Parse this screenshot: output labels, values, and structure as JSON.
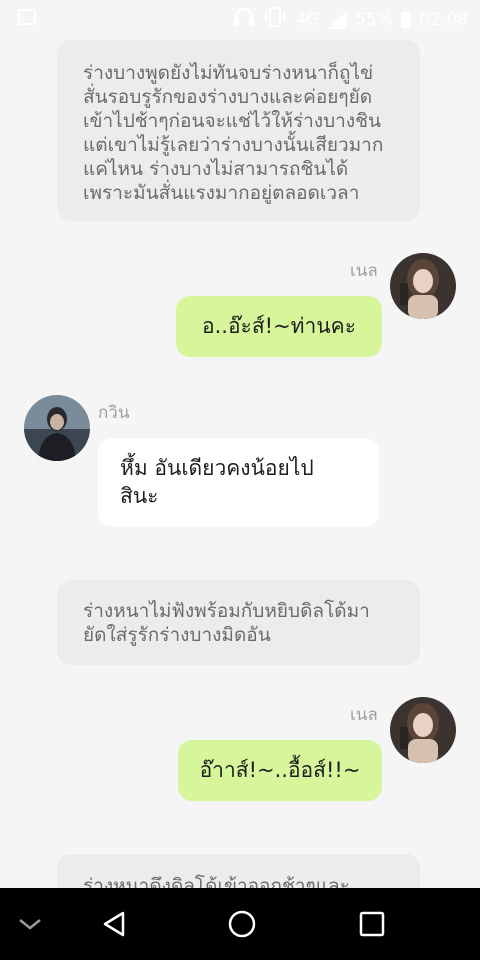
{
  "status_bar": {
    "network": "4G",
    "battery": "55%",
    "time": "02:08"
  },
  "messages": {
    "narration1": "ร่างบางพูดยังไม่ทันจบร่างหนาก็ถูไข่\nสั่นรอบรูรักของร่างบางและค่อยๆยัด\nเข้าไปช้าๆก่อนจะแช่ไว้ให้ร่างบางชิน\nแต่เขาไม่รู้เลยว่าร่างบางนั้นเสียวมาก\nแค่ไหน ร่างบางไม่สามารถชินได้\nเพราะมันสั่นแรงมากอยู่ตลอดเวลา",
    "nel_name_1": "เนล",
    "nel_msg_1": "อ..อ๊ะส์!~ท่านคะ",
    "gwin_name": "กวิน",
    "gwin_msg": "หึ้ม อันเดียวคงน้อยไป\nสินะ",
    "narration2": "ร่างหนาไม่ฟังพร้อมกับหยิบดิลโด้มา\nยัดใส่รูรักร่างบางมิดอัน",
    "nel_name_2": "เนล",
    "nel_msg_2": "อ๊าาส์!~..อื้อส์!!~",
    "narration3": "ร่างหนาดึงดิลโด้เข้าออกช้าๆและ"
  },
  "colors": {
    "green_bubble": "#d7f59b",
    "narration_bg": "#ececec",
    "background": "#f5f5f5"
  },
  "icons": {
    "nav": [
      "chevron-down-icon",
      "back-triangle-icon",
      "home-circle-icon",
      "recents-square-icon"
    ]
  }
}
